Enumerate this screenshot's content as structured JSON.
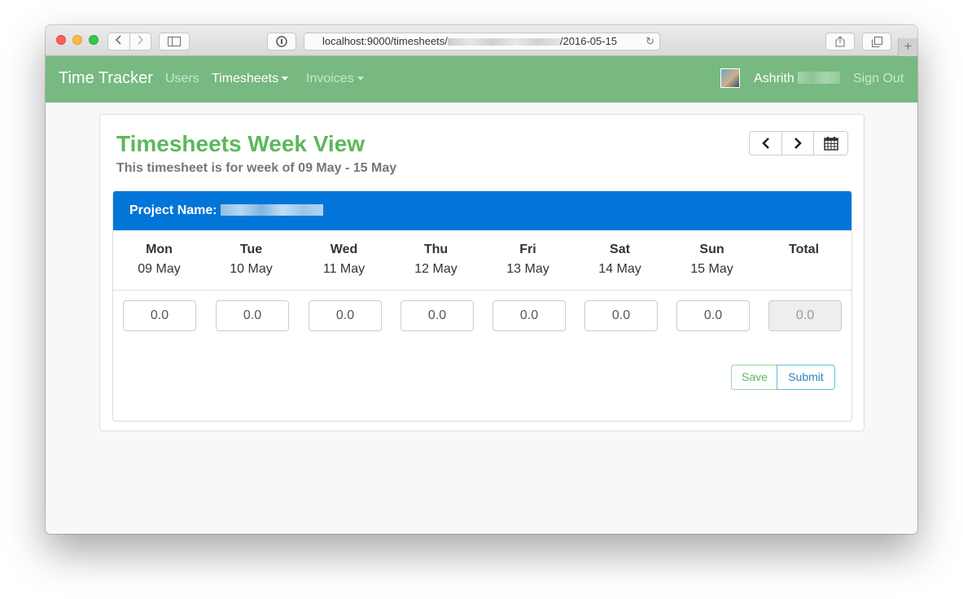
{
  "browser": {
    "url_prefix": "localhost:9000/timesheets/",
    "url_suffix": "/2016-05-15",
    "reload_icon": "reload-icon",
    "back_icon": "chevron-left-icon",
    "forward_icon": "chevron-right-icon"
  },
  "navbar": {
    "brand": "Time Tracker",
    "items": [
      {
        "label": "Users"
      },
      {
        "label": "Timesheets"
      },
      {
        "label": "Invoices"
      }
    ],
    "user_name": "Ashrith",
    "sign_out": "Sign Out",
    "color": "#77b981"
  },
  "page": {
    "title": "Timesheets Week View",
    "subtitle": "This timesheet is for week of 09 May - 15 May",
    "title_color": "#5cb85c"
  },
  "week_nav": {
    "prev_icon": "chevron-left-icon",
    "next_icon": "chevron-right-icon",
    "calendar_icon": "calendar-icon"
  },
  "project": {
    "label": "Project Name:",
    "header_color": "#0275d8"
  },
  "days": [
    {
      "name": "Mon",
      "date": "09 May",
      "hours": "0.0"
    },
    {
      "name": "Tue",
      "date": "10 May",
      "hours": "0.0"
    },
    {
      "name": "Wed",
      "date": "11 May",
      "hours": "0.0"
    },
    {
      "name": "Thu",
      "date": "12 May",
      "hours": "0.0"
    },
    {
      "name": "Fri",
      "date": "13 May",
      "hours": "0.0"
    },
    {
      "name": "Sat",
      "date": "14 May",
      "hours": "0.0"
    },
    {
      "name": "Sun",
      "date": "15 May",
      "hours": "0.0"
    }
  ],
  "total": {
    "label": "Total",
    "hours": "0.0"
  },
  "actions": {
    "save": "Save",
    "submit": "Submit"
  }
}
